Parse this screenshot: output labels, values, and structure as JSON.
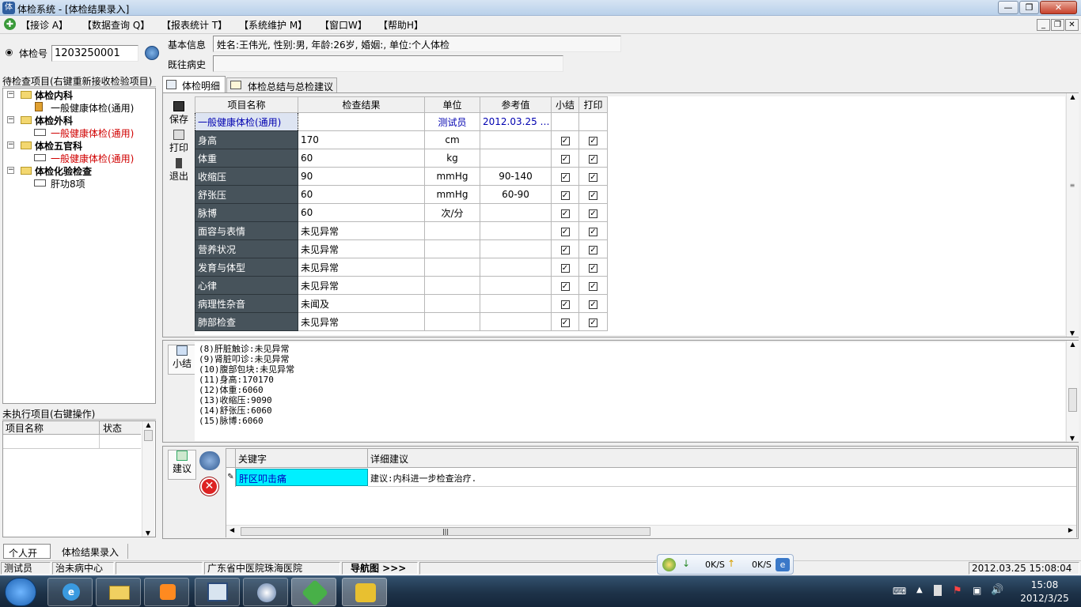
{
  "window": {
    "title": "体检系统 - [体检结果录入]"
  },
  "menu": [
    "【接诊 A】",
    "【数据查询 Q】",
    "【报表统计 T】",
    "【系统维护 M】",
    "【窗口W】",
    "【帮助H】"
  ],
  "exam": {
    "radio_label": "体检号",
    "exam_no": "1203250001"
  },
  "basic": {
    "label": "基本信息",
    "value": "姓名:王伟光, 性别:男, 年龄:26岁, 婚姻:, 单位:个人体检",
    "history_label": "既往病史",
    "history_value": ""
  },
  "tree": {
    "title": "待检查项目(右键重新接收检验项目)",
    "nodes": [
      {
        "label": "体检内科"
      },
      {
        "label": "一般健康体检(通用)"
      },
      {
        "label": "体检外科"
      },
      {
        "label": "一般健康体检(通用)"
      },
      {
        "label": "体检五官科"
      },
      {
        "label": "一般健康体检(通用)"
      },
      {
        "label": "体检化验检查"
      },
      {
        "label": "肝功8项"
      }
    ]
  },
  "unexec": {
    "title": "未执行项目(右键操作)",
    "col_name": "项目名称",
    "col_status": "状态"
  },
  "tabs": {
    "detail": "体检明细",
    "summary": "体检总结与总检建议"
  },
  "toolbar": {
    "save": "保存",
    "print": "打印",
    "exit": "退出"
  },
  "grid": {
    "headers": [
      "项目名称",
      "检查结果",
      "单位",
      "参考值",
      "小结",
      "打印"
    ],
    "first_row": {
      "name": "一般健康体检(通用)",
      "result": "",
      "unit": "测试员",
      "ref": "2012.03.25 …"
    },
    "rows": [
      {
        "name": "身高",
        "result": "170",
        "unit": "cm",
        "ref": ""
      },
      {
        "name": "体重",
        "result": "60",
        "unit": "kg",
        "ref": ""
      },
      {
        "name": "收缩压",
        "result": "90",
        "unit": "mmHg",
        "ref": "90-140"
      },
      {
        "name": "舒张压",
        "result": "60",
        "unit": "mmHg",
        "ref": "60-90"
      },
      {
        "name": "脉博",
        "result": "60",
        "unit": "次/分",
        "ref": ""
      },
      {
        "name": "面容与表情",
        "result": "未见异常",
        "unit": "",
        "ref": ""
      },
      {
        "name": "营养状况",
        "result": "未见异常",
        "unit": "",
        "ref": ""
      },
      {
        "name": "发育与体型",
        "result": "未见异常",
        "unit": "",
        "ref": ""
      },
      {
        "name": "心律",
        "result": "未见异常",
        "unit": "",
        "ref": ""
      },
      {
        "name": "病理性杂音",
        "result": "未闻及",
        "unit": "",
        "ref": ""
      },
      {
        "name": "肺部检查",
        "result": "未见异常",
        "unit": "",
        "ref": ""
      }
    ]
  },
  "summary": {
    "label": "小结",
    "lines": [
      "(8)肝脏触诊:未见异常",
      "(9)肾脏叩诊:未见异常",
      "(10)腹部包块:未见异常",
      "(11)身高:170170",
      "(12)体重:6060",
      "(13)收缩压:9090",
      "(14)舒张压:6060",
      "(15)脉博:6060"
    ]
  },
  "advice": {
    "label": "建议",
    "col_keyword": "关键字",
    "col_detail": "详细建议",
    "keyword": "肝区叩击痛",
    "detail": "建议:内科进一步检查治疗."
  },
  "bottom_tabs": [
    "个人开单",
    "体检结果录入"
  ],
  "status": {
    "user": "测试员",
    "dept": "治未病中心",
    "hospital": "广东省中医院珠海医院",
    "nav": "导航图 >>>",
    "datetime": "2012.03.25 15:08:04"
  },
  "net": {
    "down": "0K/S",
    "up": "0K/S"
  },
  "clock": {
    "time": "15:08",
    "date": "2012/3/25"
  }
}
